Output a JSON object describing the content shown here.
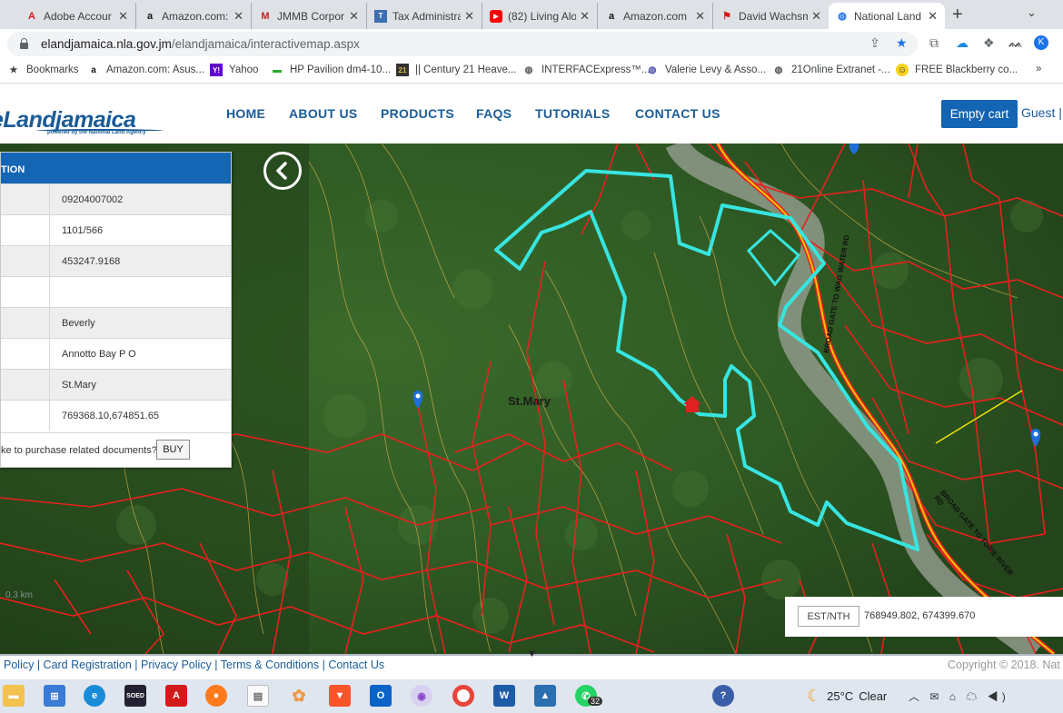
{
  "browser": {
    "tabs": [
      {
        "title": "Adobe Accour",
        "icon": "adobe-icon",
        "active": false
      },
      {
        "title": "Amazon.com:",
        "icon": "amazon-icon",
        "active": false
      },
      {
        "title": "JMMB Corpor",
        "icon": "gmail-icon",
        "active": false
      },
      {
        "title": "Tax Administra",
        "icon": "tax-icon",
        "active": false
      },
      {
        "title": "(82) Living Alo",
        "icon": "youtube-icon",
        "active": false
      },
      {
        "title": "Amazon.com",
        "icon": "amazon-icon",
        "active": false
      },
      {
        "title": "David Wachsm",
        "icon": "bookmark-red-icon",
        "active": false
      },
      {
        "title": "National Land",
        "icon": "globe-icon",
        "active": true
      }
    ],
    "url_domain": "elandjamaica.nla.gov.jm",
    "url_path": "/elandjamaica/interactivemap.aspx",
    "bookmarks": [
      {
        "label": "Bookmarks",
        "icon": "star-icon"
      },
      {
        "label": "Amazon.com: Asus...",
        "icon": "amazon-icon"
      },
      {
        "label": "Yahoo",
        "icon": "yahoo-icon"
      },
      {
        "label": "HP Pavilion dm4-10...",
        "icon": "battery-icon"
      },
      {
        "label": "|| Century 21 Heave...",
        "icon": "c21-icon"
      },
      {
        "label": "INTERFACExpress™...",
        "icon": "globe-icon"
      },
      {
        "label": "Valerie Levy & Asso...",
        "icon": "globe-icon"
      },
      {
        "label": "21Online Extranet -...",
        "icon": "globe-icon"
      },
      {
        "label": "FREE Blackberry co...",
        "icon": "smiley-icon"
      }
    ],
    "bookmarks_more": "»"
  },
  "site": {
    "logo": "eLandjamaica",
    "logo_tagline": "powered by the National Land Agency",
    "nav": [
      "HOME",
      "ABOUT US",
      "PRODUCTS",
      "FAQS",
      "TUTORIALS",
      "CONTACT US"
    ],
    "cart_label": "Empty cart",
    "guest_label": "Guest |"
  },
  "info_panel": {
    "header": "TION",
    "rows": [
      {
        "value": "09204007002"
      },
      {
        "value": "1101/566"
      },
      {
        "value": "453247.9168"
      },
      {
        "value": ""
      },
      {
        "value": "Beverly"
      },
      {
        "value": "Annotto Bay P O"
      },
      {
        "value": "St.Mary"
      },
      {
        "value": "769368.10,674851.65"
      }
    ],
    "purchase_prompt": "ke to purchase related documents?",
    "buy_label": "BUY"
  },
  "map": {
    "parish_label": "St.Mary",
    "scale_label": "0.3 km",
    "road_labels": [
      "BROAD GATE TO WAG WATER RD",
      "BROAD GATE TO TORIE RIVER RD"
    ],
    "coord_label": "EST/NTH",
    "coord_value": "768949.802, 674399.670",
    "colors": {
      "parcel": "#e8201e",
      "selected": "#37e5e0",
      "contour": "#d8b24a",
      "road": "#f0c400"
    }
  },
  "footer": {
    "links": "Policy | Card Registration | Privacy Policy | Terms & Conditions | Contact Us",
    "copyright": "Copyright © 2018. Nat"
  },
  "taskbar": {
    "apps": [
      "file-explorer-icon",
      "store-icon",
      "edge-icon",
      "soed-icon",
      "acrobat-icon",
      "firefox-icon",
      "notepad-icon",
      "photos-icon",
      "brave-icon",
      "outlook-icon",
      "camera-icon",
      "chrome-icon",
      "word-icon",
      "photos-app-icon",
      "whatsapp-icon"
    ],
    "whatsapp_badge": "32",
    "weather_temp": "25°C",
    "weather_text": "Clear"
  }
}
